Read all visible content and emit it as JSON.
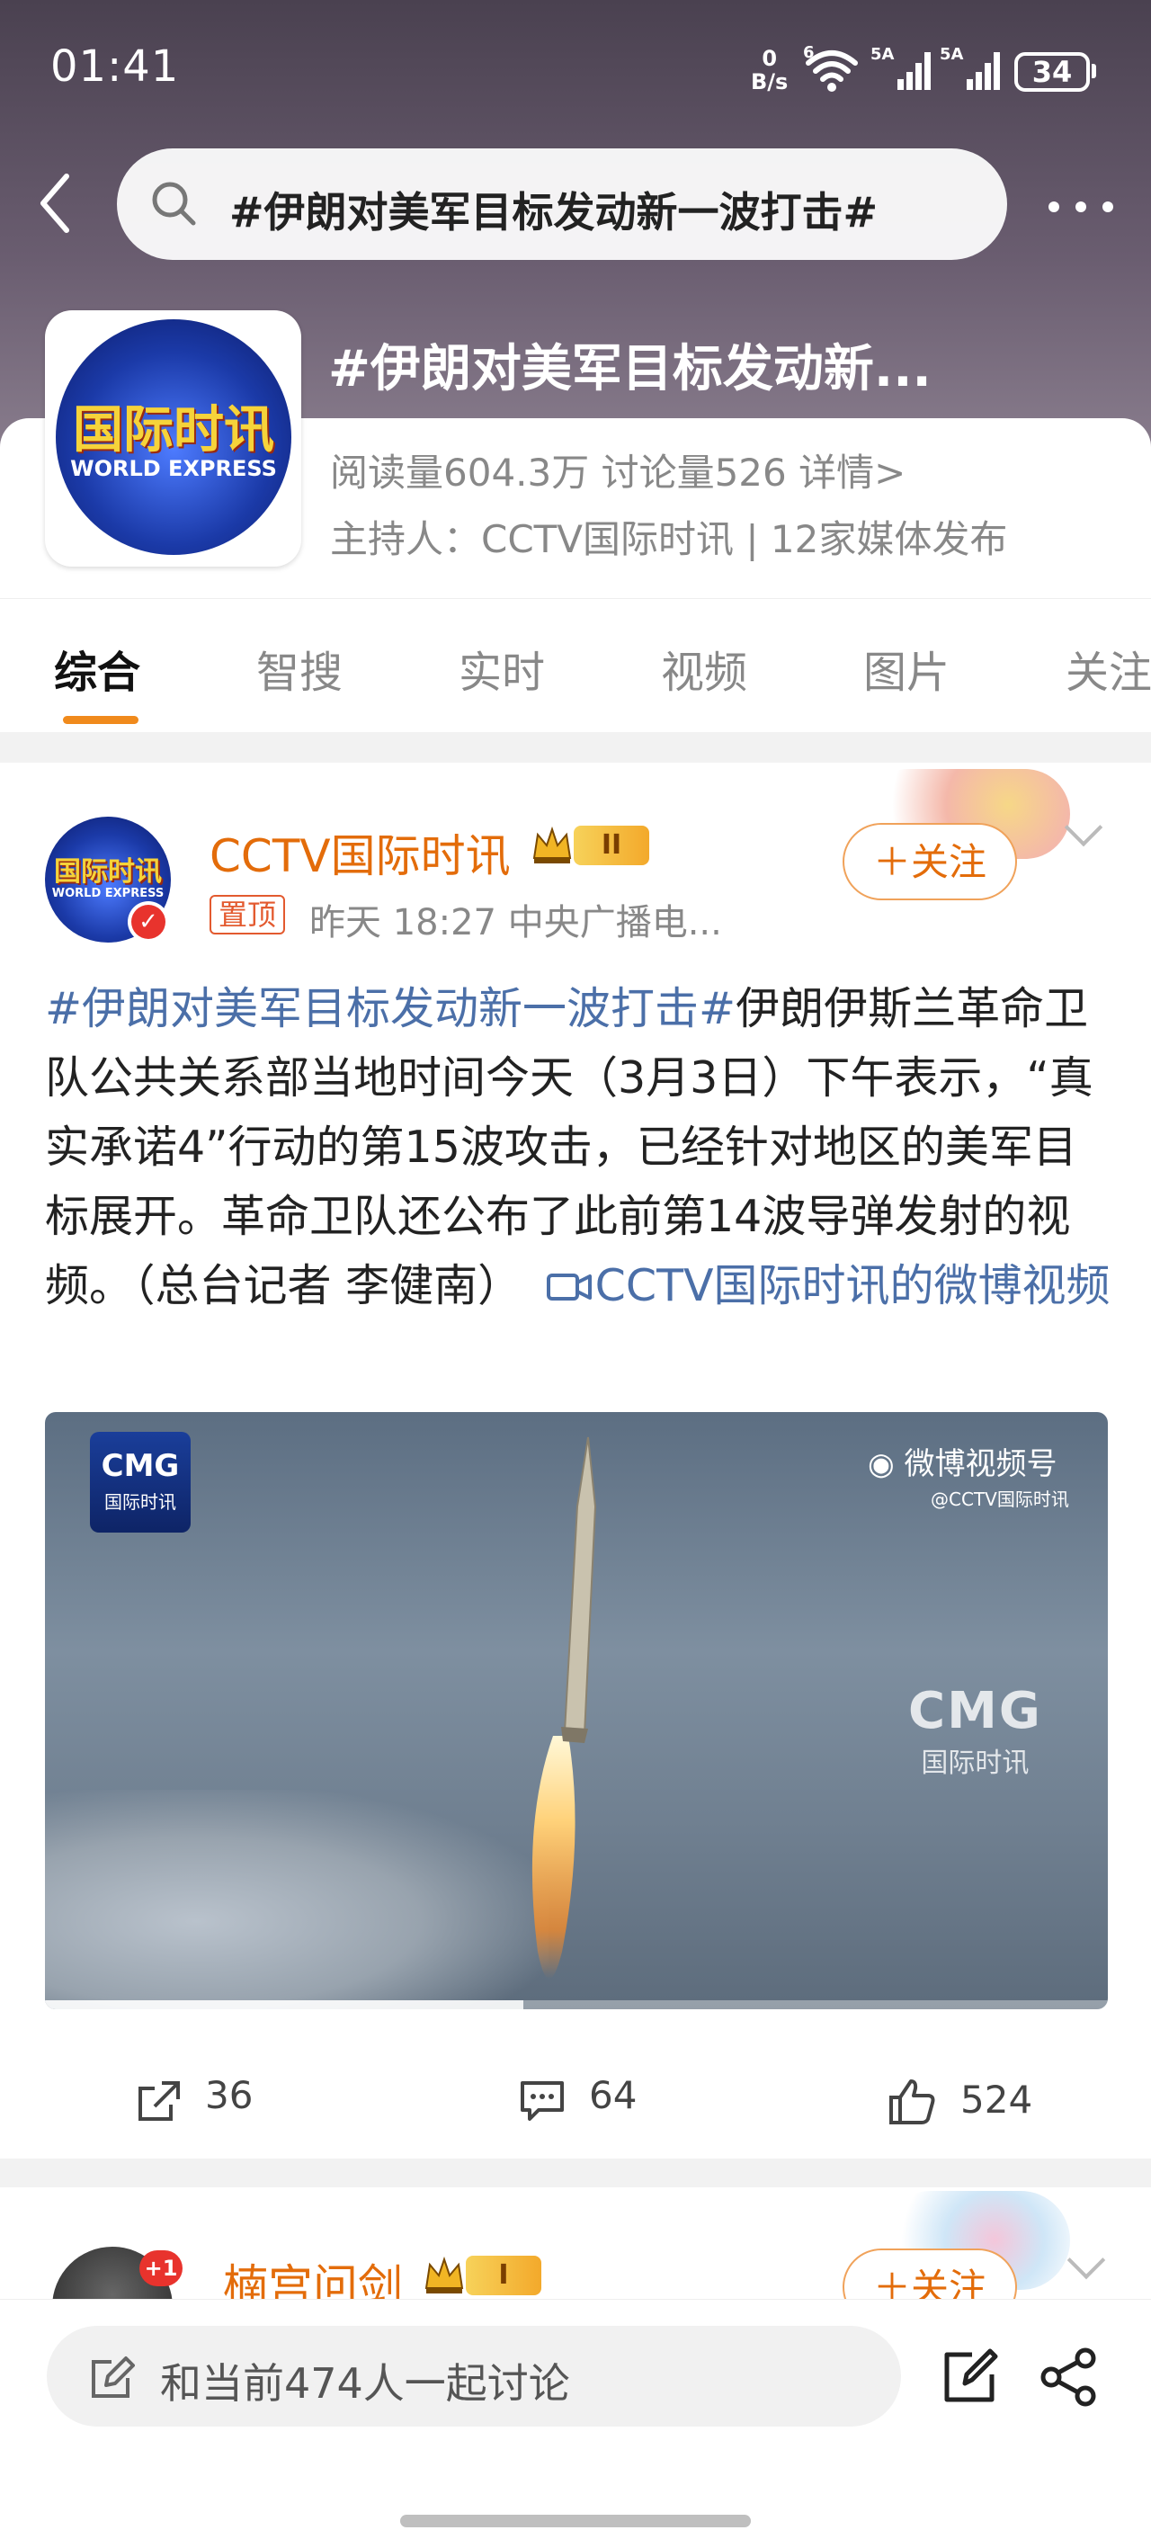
{
  "status_bar": {
    "time": "01:41",
    "net_speed_value": "0",
    "net_speed_unit": "B/s",
    "wifi_label": "6",
    "sim1_label": "5A",
    "sim2_label": "5A",
    "battery": "34"
  },
  "nav": {
    "search_text": "#伊朗对美军目标发动新一波打击#"
  },
  "topic": {
    "logo_cn": "国际时讯",
    "logo_en": "WORLD EXPRESS",
    "title": "#伊朗对美军目标发动新...",
    "stats": "阅读量604.3万  讨论量526  详情>",
    "host": "主持人：CCTV国际时讯 | 12家媒体发布"
  },
  "tabs": [
    "综合",
    "智搜",
    "实时",
    "视频",
    "图片",
    "关注"
  ],
  "post1": {
    "author": "CCTV国际时讯",
    "rank": "II",
    "pin_label": "置顶",
    "meta": "昨天 18:27  中央广播电...",
    "follow_label": "＋关注",
    "hashtag": "#伊朗对美军目标发动新一波打击#",
    "body": "伊朗伊斯兰革命卫队公共关系部当地时间今天（3月3日）下午表示，“真实承诺4”行动的第15波攻击，已经针对地区的美军目标展开。革命卫队还公布了此前第14波导弹发射的视频。（总台记者 李健南）",
    "video_link": "CCTV国际时讯的微博视频",
    "video": {
      "badge_title": "CMG",
      "badge_sub": "国际时讯",
      "weibo_mark": "微博视频号",
      "weibo_handle": "@CCTV国际时讯",
      "watermark_title": "CMG",
      "watermark_sub": "国际时讯",
      "progress": 0.45
    },
    "shares": "36",
    "comments": "64",
    "likes": "524"
  },
  "post2": {
    "author": "楠宫问剑",
    "rank": "I",
    "avatar_badge": "+1",
    "follow_label": "＋关注"
  },
  "bottom": {
    "comment_placeholder": "和当前474人一起讨论"
  }
}
